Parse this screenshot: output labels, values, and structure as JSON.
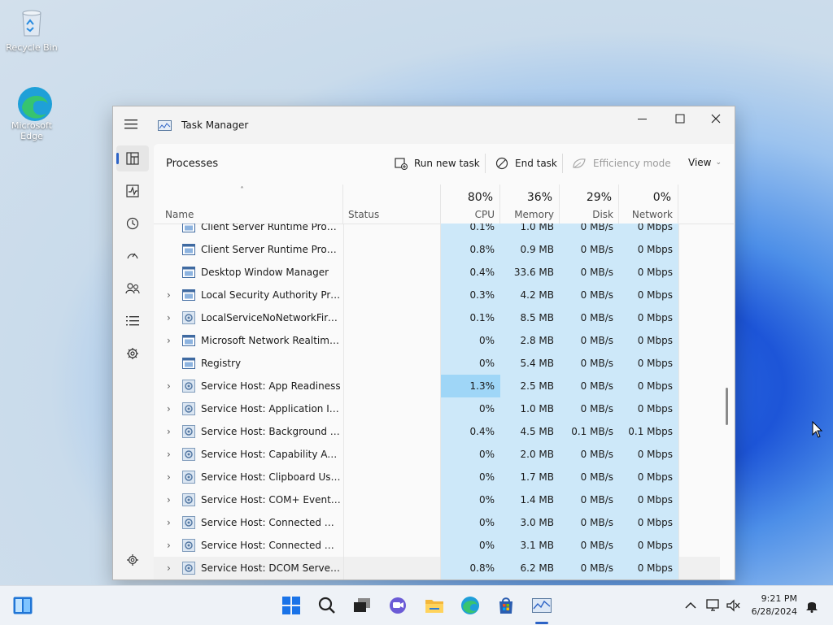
{
  "desktop": {
    "icons": [
      {
        "label": "Recycle Bin",
        "icon": "recycle-bin-icon"
      },
      {
        "label": "Microsoft Edge",
        "icon": "edge-icon"
      }
    ]
  },
  "window": {
    "title": "Task Manager",
    "page_title": "Processes",
    "commands": {
      "run_new_task": "Run new task",
      "end_task": "End task",
      "efficiency_mode": "Efficiency mode",
      "view": "View"
    },
    "nav_items": [
      "processes-icon",
      "performance-icon",
      "app-history-icon",
      "startup-apps-icon",
      "users-icon",
      "details-icon",
      "services-icon",
      "settings-icon"
    ],
    "columns": {
      "name": "Name",
      "status": "Status",
      "cpu": {
        "percent": "80%",
        "label": "CPU"
      },
      "memory": {
        "percent": "36%",
        "label": "Memory"
      },
      "disk": {
        "percent": "29%",
        "label": "Disk"
      },
      "network": {
        "percent": "0%",
        "label": "Network"
      }
    },
    "processes": [
      {
        "name": "Client Server Runtime Process",
        "expandable": false,
        "icon": "window-process-icon",
        "cpu": "0.1%",
        "memory": "1.0 MB",
        "disk": "0 MB/s",
        "network": "0 Mbps"
      },
      {
        "name": "Client Server Runtime Process",
        "expandable": false,
        "icon": "window-process-icon",
        "cpu": "0.8%",
        "memory": "0.9 MB",
        "disk": "0 MB/s",
        "network": "0 Mbps"
      },
      {
        "name": "Desktop Window Manager",
        "expandable": false,
        "icon": "window-process-icon",
        "cpu": "0.4%",
        "memory": "33.6 MB",
        "disk": "0 MB/s",
        "network": "0 Mbps"
      },
      {
        "name": "Local Security Authority Proce...",
        "expandable": true,
        "icon": "window-process-icon",
        "cpu": "0.3%",
        "memory": "4.2 MB",
        "disk": "0 MB/s",
        "network": "0 Mbps"
      },
      {
        "name": "LocalServiceNoNetworkFirewa...",
        "expandable": true,
        "icon": "gear-process-icon",
        "cpu": "0.1%",
        "memory": "8.5 MB",
        "disk": "0 MB/s",
        "network": "0 Mbps"
      },
      {
        "name": "Microsoft Network Realtime I...",
        "expandable": true,
        "icon": "window-process-icon",
        "cpu": "0%",
        "memory": "2.8 MB",
        "disk": "0 MB/s",
        "network": "0 Mbps"
      },
      {
        "name": "Registry",
        "expandable": false,
        "icon": "window-process-icon",
        "cpu": "0%",
        "memory": "5.4 MB",
        "disk": "0 MB/s",
        "network": "0 Mbps"
      },
      {
        "name": "Service Host: App Readiness",
        "expandable": true,
        "icon": "gear-process-icon",
        "cpu": "1.3%",
        "memory": "2.5 MB",
        "disk": "0 MB/s",
        "network": "0 Mbps",
        "cpu_hot": true
      },
      {
        "name": "Service Host: Application Infor...",
        "expandable": true,
        "icon": "gear-process-icon",
        "cpu": "0%",
        "memory": "1.0 MB",
        "disk": "0 MB/s",
        "network": "0 Mbps"
      },
      {
        "name": "Service Host: Background Inte...",
        "expandable": true,
        "icon": "gear-process-icon",
        "cpu": "0.4%",
        "memory": "4.5 MB",
        "disk": "0.1 MB/s",
        "network": "0.1 Mbps"
      },
      {
        "name": "Service Host: Capability Acces...",
        "expandable": true,
        "icon": "gear-process-icon",
        "cpu": "0%",
        "memory": "2.0 MB",
        "disk": "0 MB/s",
        "network": "0 Mbps"
      },
      {
        "name": "Service Host: Clipboard User S...",
        "expandable": true,
        "icon": "gear-process-icon",
        "cpu": "0%",
        "memory": "1.7 MB",
        "disk": "0 MB/s",
        "network": "0 Mbps"
      },
      {
        "name": "Service Host: COM+ Event Sys...",
        "expandable": true,
        "icon": "gear-process-icon",
        "cpu": "0%",
        "memory": "1.4 MB",
        "disk": "0 MB/s",
        "network": "0 Mbps"
      },
      {
        "name": "Service Host: Connected Devi...",
        "expandable": true,
        "icon": "gear-process-icon",
        "cpu": "0%",
        "memory": "3.0 MB",
        "disk": "0 MB/s",
        "network": "0 Mbps"
      },
      {
        "name": "Service Host: Connected Devi...",
        "expandable": true,
        "icon": "gear-process-icon",
        "cpu": "0%",
        "memory": "3.1 MB",
        "disk": "0 MB/s",
        "network": "0 Mbps"
      },
      {
        "name": "Service Host: DCOM Server Pr...",
        "expandable": true,
        "icon": "gear-process-icon",
        "cpu": "0.8%",
        "memory": "6.2 MB",
        "disk": "0 MB/s",
        "network": "0 Mbps"
      }
    ]
  },
  "taskbar": {
    "items": [
      "widgets-icon",
      "start-icon",
      "search-icon",
      "task-view-icon",
      "chat-icon",
      "file-explorer-icon",
      "edge-icon",
      "store-icon",
      "task-manager-icon"
    ],
    "time": "9:21 PM",
    "date": "6/28/2024"
  },
  "colors": {
    "accent": "#2c63c6",
    "cpu_shade": "#cde8f9",
    "cpu_hot": "#9fd6f7"
  }
}
